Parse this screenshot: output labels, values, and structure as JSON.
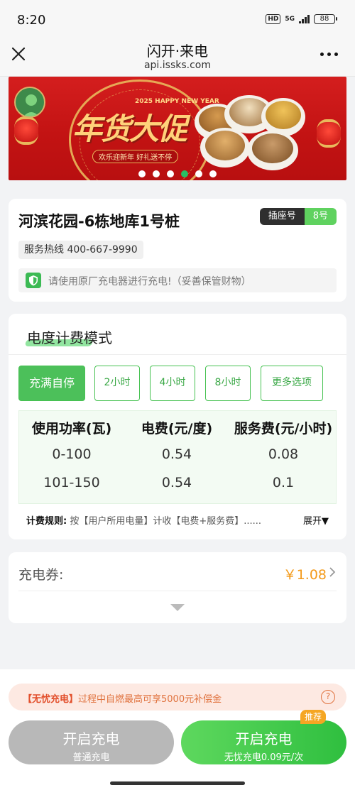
{
  "status_bar": {
    "time": "8:20",
    "hd": "HD",
    "network": "5G",
    "battery": "88"
  },
  "nav": {
    "title": "闪开·来电",
    "url": "api.issks.com"
  },
  "banner": {
    "year": "2025 HAPPY NEW YEAR",
    "title": "年货大促",
    "subtitle": "欢乐迎新年  好礼送不停",
    "slide_count": 6,
    "active_slide": 3
  },
  "station": {
    "name": "河滨花园-6栋地库1号桩",
    "socket_label": "插座号",
    "socket_number": "8号",
    "hotline": "服务热线 400-667-9990",
    "notice": "请使用原厂充电器进行充电!（妥善保管财物）"
  },
  "billing": {
    "section_title": "电度计费模式",
    "options": [
      "充满自停",
      "2小时",
      "4小时",
      "8小时",
      "更多选项"
    ],
    "selected_option": "充满自停",
    "table": {
      "headers": [
        "使用功率(瓦)",
        "电费(元/度)",
        "服务费(元/小时)"
      ],
      "rows": [
        [
          "0-100",
          "0.54",
          "0.08"
        ],
        [
          "101-150",
          "0.54",
          "0.1"
        ]
      ]
    },
    "rule_label": "计费规则:",
    "rule_text": "按【用户所用电量】计收【电费+服务费】......",
    "expand_label": "展开▼"
  },
  "coupon": {
    "label": "充电券:",
    "value": "￥1.08"
  },
  "footer": {
    "tip_tag": "【无忧充电】",
    "tip_text": "过程中自燃最高可享5000元补偿金",
    "tip_help": "?",
    "normal_button": {
      "main": "开启充电",
      "sub": "普通充电"
    },
    "worry_button": {
      "main": "开启充电",
      "sub": "无忧充电0.09元/次"
    },
    "recommend_badge": "推荐"
  },
  "colors": {
    "accent_green": "#4cc05a",
    "coupon_orange": "#f39a1a",
    "banner_red": "#c31313"
  }
}
